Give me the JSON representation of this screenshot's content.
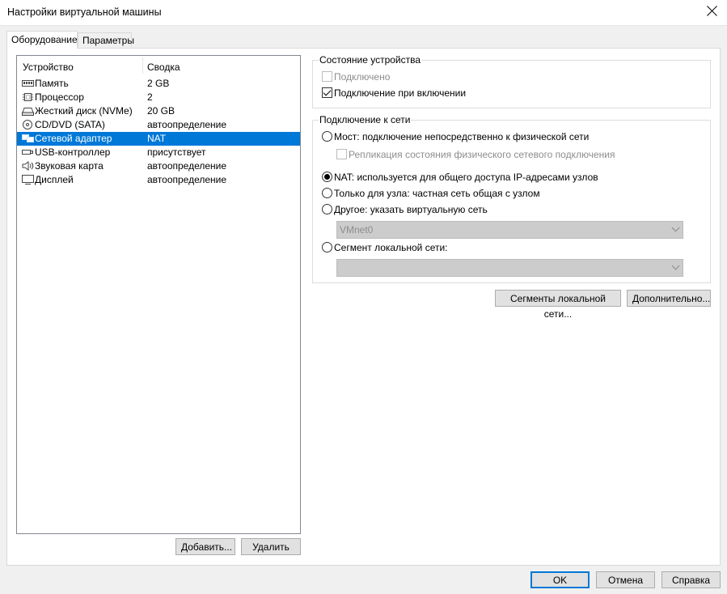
{
  "window": {
    "title": "Настройки виртуальной машины"
  },
  "tabs": [
    {
      "label": "Оборудование",
      "active": true
    },
    {
      "label": "Параметры",
      "active": false
    }
  ],
  "devices": {
    "header": {
      "device": "Устройство",
      "summary": "Сводка"
    },
    "items": [
      {
        "name": "Память",
        "summary": "2 GB",
        "icon": "memory-icon"
      },
      {
        "name": "Процессор",
        "summary": "2",
        "icon": "cpu-icon"
      },
      {
        "name": "Жесткий диск (NVMe)",
        "summary": "20 GB",
        "icon": "hard-disk-icon"
      },
      {
        "name": "CD/DVD (SATA)",
        "summary": "автоопределение",
        "icon": "cd-dvd-icon"
      },
      {
        "name": "Сетевой адаптер",
        "summary": "NAT",
        "icon": "network-adapter-icon",
        "selected": true
      },
      {
        "name": "USB-контроллер",
        "summary": "присутствует",
        "icon": "usb-icon"
      },
      {
        "name": "Звуковая карта",
        "summary": "автоопределение",
        "icon": "sound-card-icon"
      },
      {
        "name": "Дисплей",
        "summary": "автоопределение",
        "icon": "display-icon"
      }
    ],
    "add_button": "Добавить...",
    "remove_button": "Удалить"
  },
  "device_status": {
    "title": "Состояние устройства",
    "connected": {
      "label": "Подключено",
      "checked": false,
      "disabled": true
    },
    "connect_at_power_on": {
      "label": "Подключение при включении",
      "checked": true
    }
  },
  "network_connection": {
    "title": "Подключение к сети",
    "bridged": {
      "label": "Мост: подключение непосредственно к физической сети",
      "checked": false
    },
    "replicate": {
      "label": "Репликация состояния физического сетевого подключения",
      "checked": false,
      "disabled": true
    },
    "nat": {
      "label": "NAT: используется для общего доступа IP-адресами узлов",
      "checked": true
    },
    "host_only": {
      "label": "Только для узла: частная сеть общая с узлом",
      "checked": false
    },
    "custom": {
      "label": "Другое: указать виртуальную сеть",
      "checked": false
    },
    "custom_value": "VMnet0",
    "lan_segment": {
      "label": "Сегмент локальной сети:",
      "checked": false
    },
    "lan_segment_value": ""
  },
  "buttons": {
    "lan_segments": "Сегменты локальной сети...",
    "advanced": "Дополнительно...",
    "ok": "OK",
    "cancel": "Отмена",
    "help": "Справка"
  },
  "colors": {
    "selection": "#0078d7",
    "default_button_border": "#0078d7"
  }
}
